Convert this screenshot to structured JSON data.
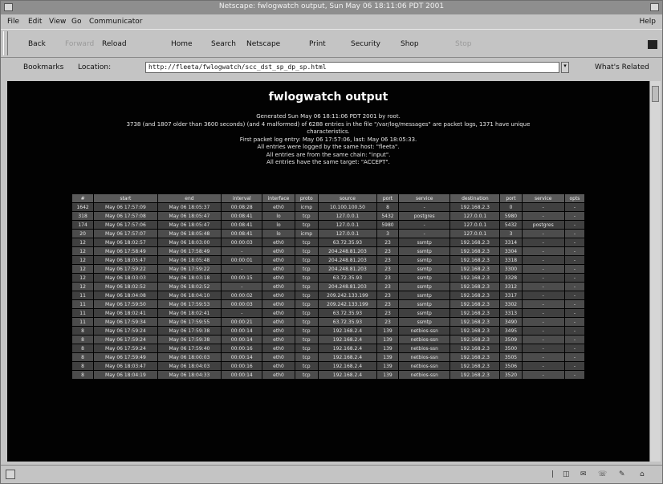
{
  "window": {
    "title": "Netscape: fwlogwatch output, Sun May 06 18:11:06 PDT 2001"
  },
  "menubar": {
    "items": [
      "File",
      "Edit",
      "View",
      "Go",
      "Communicator"
    ],
    "help": "Help"
  },
  "navbar": {
    "back": "Back",
    "forward": "Forward",
    "reload": "Reload",
    "home": "Home",
    "search": "Search",
    "netscape": "Netscape",
    "print": "Print",
    "security": "Security",
    "shop": "Shop",
    "stop": "Stop"
  },
  "locbar": {
    "bookmarks": "Bookmarks",
    "location_label": "Location:",
    "url": "http://fleeta/fwlogwatch/scc_dst_sp_dp_sp.html",
    "whats_related": "What's Related"
  },
  "page": {
    "heading": "fwlogwatch output",
    "info": [
      "Generated Sun May 06 18:11:06 PDT 2001 by root.",
      "3738 (and 1807 older than 3600 seconds) (and 4 malformed) of 6288 entries in the file \"/var/log/messages\" are packet logs, 1371 have unique",
      "characteristics.",
      "First packet log entry: May 06 17:57:06, last: May 06 18:05:33.",
      "All entries were logged by the same host: \"fleeta\".",
      "All entries are from the same chain: \"input\".",
      "All entries have the same target: \"ACCEPT\"."
    ],
    "table": {
      "headers": [
        "#",
        "start",
        "end",
        "interval",
        "interface",
        "proto",
        "source",
        "port",
        "service",
        "destination",
        "port",
        "service",
        "opts"
      ],
      "rows": [
        [
          "1642",
          "May 06 17:57:09",
          "May 06 18:05:37",
          "00:08:28",
          "eth0",
          "icmp",
          "10.100.100.50",
          "8",
          "-",
          "192.168.2.3",
          "0",
          "-",
          "-"
        ],
        [
          "318",
          "May 06 17:57:08",
          "May 06 18:05:47",
          "00:08:41",
          "lo",
          "tcp",
          "127.0.0.1",
          "5432",
          "postgres",
          "127.0.0.1",
          "5980",
          "-",
          "-"
        ],
        [
          "174",
          "May 06 17:57:06",
          "May 06 18:05:47",
          "00:08:41",
          "lo",
          "tcp",
          "127.0.0.1",
          "5980",
          "-",
          "127.0.0.1",
          "5432",
          "postgres",
          "-"
        ],
        [
          "20",
          "May 06 17:57:07",
          "May 06 18:05:48",
          "00:08:41",
          "lo",
          "icmp",
          "127.0.0.1",
          "3",
          "-",
          "127.0.0.1",
          "3",
          "-",
          "-"
        ],
        [
          "12",
          "May 06 18:02:57",
          "May 06 18:03:00",
          "00:00:03",
          "eth0",
          "tcp",
          "63.72.35.93",
          "23",
          "ssmtp",
          "192.168.2.3",
          "3314",
          "-",
          "-"
        ],
        [
          "12",
          "May 06 17:58:49",
          "May 06 17:58:49",
          "-",
          "eth0",
          "tcp",
          "204.248.81.203",
          "23",
          "ssmtp",
          "192.168.2.3",
          "3304",
          "-",
          "-"
        ],
        [
          "12",
          "May 06 18:05:47",
          "May 06 18:05:48",
          "00:00:01",
          "eth0",
          "tcp",
          "204.248.81.203",
          "23",
          "ssmtp",
          "192.168.2.3",
          "3318",
          "-",
          "-"
        ],
        [
          "12",
          "May 06 17:59:22",
          "May 06 17:59:22",
          "-",
          "eth0",
          "tcp",
          "204.248.81.203",
          "23",
          "ssmtp",
          "192.168.2.3",
          "3300",
          "-",
          "-"
        ],
        [
          "12",
          "May 06 18:03:03",
          "May 06 18:03:18",
          "00:00:15",
          "eth0",
          "tcp",
          "63.72.35.93",
          "23",
          "ssmtp",
          "192.168.2.3",
          "3328",
          "-",
          "-"
        ],
        [
          "12",
          "May 06 18:02:52",
          "May 06 18:02:52",
          "-",
          "eth0",
          "tcp",
          "204.248.81.203",
          "23",
          "ssmtp",
          "192.168.2.3",
          "3312",
          "-",
          "-"
        ],
        [
          "11",
          "May 06 18:04:08",
          "May 06 18:04:10",
          "00:00:02",
          "eth0",
          "tcp",
          "209.242.133.199",
          "23",
          "ssmtp",
          "192.168.2.3",
          "3317",
          "-",
          "-"
        ],
        [
          "11",
          "May 06 17:59:50",
          "May 06 17:59:53",
          "00:00:03",
          "eth0",
          "tcp",
          "209.242.133.199",
          "23",
          "ssmtp",
          "192.168.2.3",
          "3302",
          "-",
          "-"
        ],
        [
          "11",
          "May 06 18:02:41",
          "May 06 18:02:41",
          "-",
          "eth0",
          "tcp",
          "63.72.35.93",
          "23",
          "ssmtp",
          "192.168.2.3",
          "3313",
          "-",
          "-"
        ],
        [
          "11",
          "May 06 17:59:34",
          "May 06 17:59:55",
          "00:00:21",
          "eth0",
          "tcp",
          "63.72.35.93",
          "23",
          "ssmtp",
          "192.168.2.3",
          "3490",
          "-",
          "-"
        ],
        [
          "8",
          "May 06 17:59:24",
          "May 06 17:59:38",
          "00:00:14",
          "eth0",
          "tcp",
          "192.168.2.4",
          "139",
          "netbios-ssn",
          "192.168.2.3",
          "3495",
          "-",
          "-"
        ],
        [
          "8",
          "May 06 17:59:24",
          "May 06 17:59:38",
          "00:00:14",
          "eth0",
          "tcp",
          "192.168.2.4",
          "139",
          "netbios-ssn",
          "192.168.2.3",
          "3509",
          "-",
          "-"
        ],
        [
          "8",
          "May 06 17:59:24",
          "May 06 17:59:40",
          "00:00:16",
          "eth0",
          "tcp",
          "192.168.2.4",
          "139",
          "netbios-ssn",
          "192.168.2.3",
          "3500",
          "-",
          "-"
        ],
        [
          "8",
          "May 06 17:59:49",
          "May 06 18:00:03",
          "00:00:14",
          "eth0",
          "tcp",
          "192.168.2.4",
          "139",
          "netbios-ssn",
          "192.168.2.3",
          "3505",
          "-",
          "-"
        ],
        [
          "8",
          "May 06 18:03:47",
          "May 06 18:04:03",
          "00:00:16",
          "eth0",
          "tcp",
          "192.168.2.4",
          "139",
          "netbios-ssn",
          "192.168.2.3",
          "3506",
          "-",
          "-"
        ],
        [
          "8",
          "May 06 18:04:19",
          "May 06 18:04:33",
          "00:00:14",
          "eth0",
          "tcp",
          "192.168.2.4",
          "139",
          "netbios-ssn",
          "192.168.2.3",
          "3520",
          "-",
          "-"
        ]
      ]
    }
  }
}
